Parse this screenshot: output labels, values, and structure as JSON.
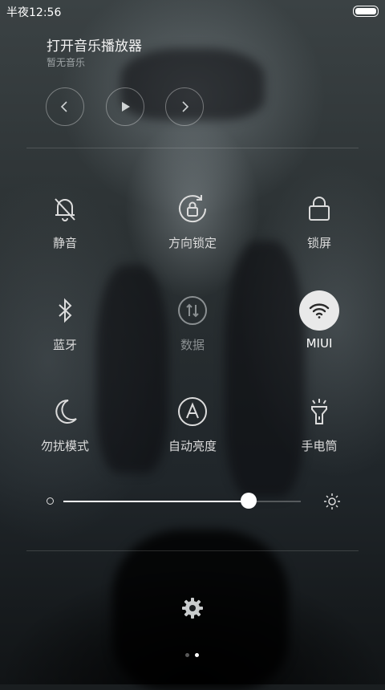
{
  "status_bar": {
    "time": "半夜12:56",
    "battery_icon": "battery-full-icon"
  },
  "music": {
    "title": "打开音乐播放器",
    "subtitle": "暂无音乐",
    "controls": [
      "previous-icon",
      "play-icon",
      "next-icon"
    ]
  },
  "toggles": [
    {
      "label": "静音",
      "icon": "mute-bell-icon",
      "state": "off"
    },
    {
      "label": "方向锁定",
      "icon": "rotation-lock-icon",
      "state": "off"
    },
    {
      "label": "锁屏",
      "icon": "lock-icon",
      "state": "off"
    },
    {
      "label": "蓝牙",
      "icon": "bluetooth-icon",
      "state": "off"
    },
    {
      "label": "数据",
      "icon": "mobile-data-icon",
      "state": "disabled"
    },
    {
      "label": "MIUI",
      "icon": "wifi-icon",
      "state": "on"
    },
    {
      "label": "勿扰模式",
      "icon": "moon-icon",
      "state": "off"
    },
    {
      "label": "自动亮度",
      "icon": "auto-brightness-icon",
      "state": "off"
    },
    {
      "label": "手电筒",
      "icon": "flashlight-icon",
      "state": "off"
    }
  ],
  "brightness": {
    "level": 0.78
  },
  "footer": {
    "settings_icon": "settings-gear-icon",
    "page_count": 2,
    "active_page": 2
  },
  "colors": {
    "active_tile_bg": "#e9e9e9",
    "text": "#dcdcdc",
    "disabled_text": "#8a8f91"
  }
}
